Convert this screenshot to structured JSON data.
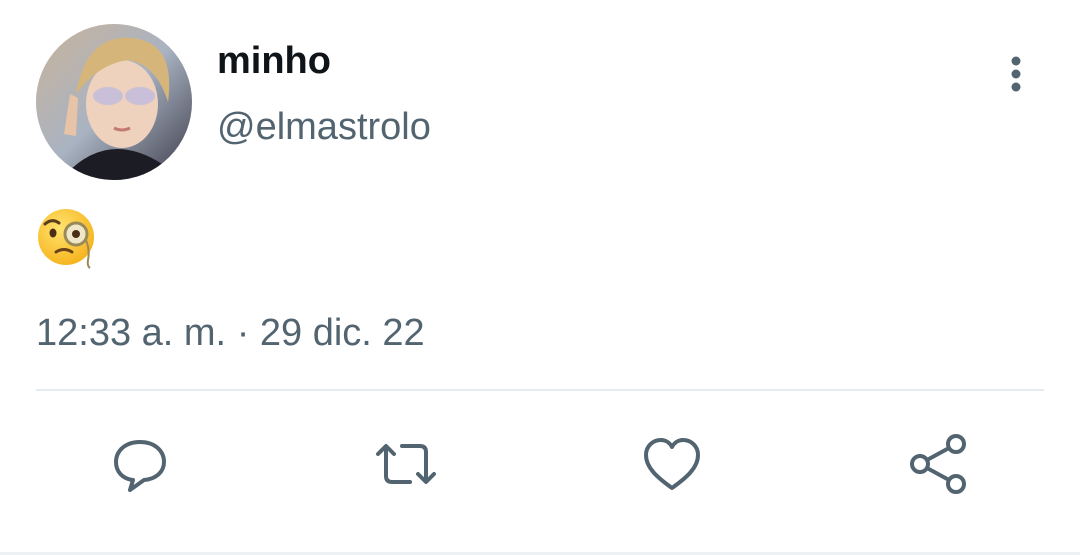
{
  "user": {
    "display_name": "minho",
    "handle": "@elmastrolo",
    "avatar_icon": "profile-photo"
  },
  "tweet": {
    "text_emoji": "face-with-monocle",
    "time": "12:33 a. m.",
    "separator": "·",
    "date": "29 dic. 22"
  },
  "actions": [
    {
      "icon": "reply-icon"
    },
    {
      "icon": "retweet-icon"
    },
    {
      "icon": "like-icon"
    },
    {
      "icon": "share-icon"
    }
  ],
  "colors": {
    "text_primary": "#0f1419",
    "text_secondary": "#536471",
    "icon": "#536471",
    "divider": "#e6ecf0"
  }
}
